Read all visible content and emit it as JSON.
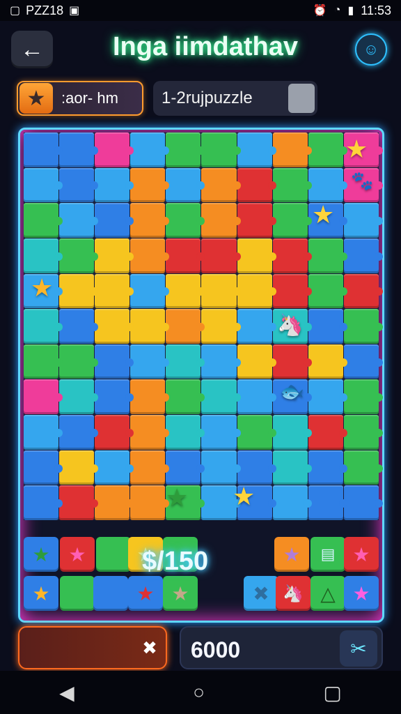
{
  "status_bar": {
    "carrier": "PZZ18",
    "time": "11:53"
  },
  "header": {
    "title": "Inga iimdathav"
  },
  "info": {
    "mode_label": ":aor- hm",
    "puzzle_label": "1-2rujpuzzle"
  },
  "tray": {
    "score": "$/150"
  },
  "bottom": {
    "value": "6000"
  },
  "colors": {
    "blue": "#2f7fe6",
    "sky": "#35a6ee",
    "teal": "#29c3c4",
    "green": "#36bf52",
    "yellow": "#f6c51f",
    "orange": "#f58d22",
    "red": "#df3133",
    "pink": "#ef3c9a"
  },
  "icons": [
    "back-arrow-icon",
    "avatar-icon",
    "star-icon",
    "close-icon",
    "tools-icon"
  ]
}
